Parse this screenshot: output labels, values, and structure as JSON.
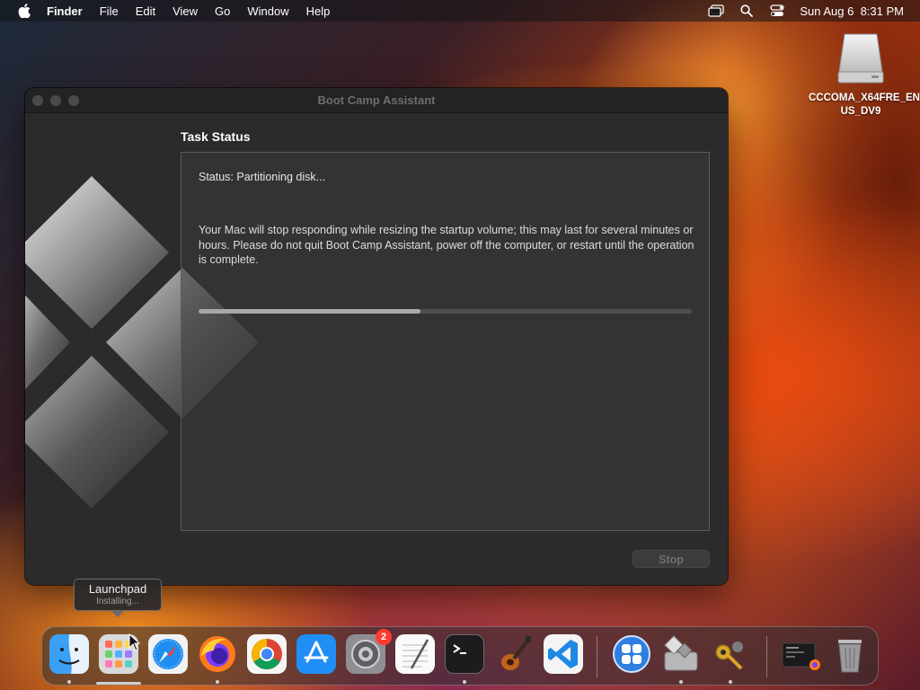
{
  "menubar": {
    "apple_icon": "apple-logo-icon",
    "app_name": "Finder",
    "items": [
      "File",
      "Edit",
      "View",
      "Go",
      "Window",
      "Help"
    ],
    "status_icons": [
      "screen-mirroring-icon",
      "spotlight-search-icon",
      "control-center-icon"
    ],
    "clock": "Sun Aug 6  8:31 PM"
  },
  "desktop": {
    "drive": {
      "icon": "external-drive-icon",
      "label": "CCCOMA_X64FRE_EN-US_DV9"
    }
  },
  "window": {
    "title": "Boot Camp Assistant",
    "task_title": "Task Status",
    "status": "Status: Partitioning disk...",
    "message": "Your Mac will stop responding while resizing the startup volume; this may last for several minutes or hours. Please do not quit Boot Camp Assistant, power off the computer, or restart until the operation is complete.",
    "progress_percent": 45,
    "stop_label": "Stop",
    "logo_icon": "windows-diamond-logo-icon"
  },
  "tooltip": {
    "title": "Launchpad",
    "subtitle": "Installing..."
  },
  "dock": {
    "items": [
      {
        "name": "finder",
        "icon": "finder-icon",
        "running": true
      },
      {
        "name": "launchpad",
        "icon": "launchpad-icon",
        "running": true
      },
      {
        "name": "safari",
        "icon": "safari-icon",
        "running": false
      },
      {
        "name": "firefox",
        "icon": "firefox-icon",
        "running": true
      },
      {
        "name": "chrome",
        "icon": "chrome-icon",
        "running": false
      },
      {
        "name": "app-store",
        "icon": "app-store-icon",
        "running": false
      },
      {
        "name": "system-settings",
        "icon": "system-settings-icon",
        "running": false,
        "badge": "2"
      },
      {
        "name": "textedit",
        "icon": "textedit-icon",
        "running": false
      },
      {
        "name": "terminal",
        "icon": "terminal-icon",
        "running": true
      },
      {
        "name": "garageband",
        "icon": "garageband-icon",
        "running": false
      },
      {
        "name": "vscode",
        "icon": "vscode-icon",
        "running": false
      },
      {
        "name": "parallels",
        "icon": "parallels-icon",
        "running": false
      },
      {
        "name": "boot-camp",
        "icon": "boot-camp-assistant-icon",
        "running": true
      },
      {
        "name": "keychain",
        "icon": "keychain-access-icon",
        "running": true
      },
      {
        "name": "downloads-stack",
        "icon": "downloads-stack-icon",
        "running": false
      },
      {
        "name": "trash",
        "icon": "trash-icon",
        "running": false
      }
    ]
  }
}
